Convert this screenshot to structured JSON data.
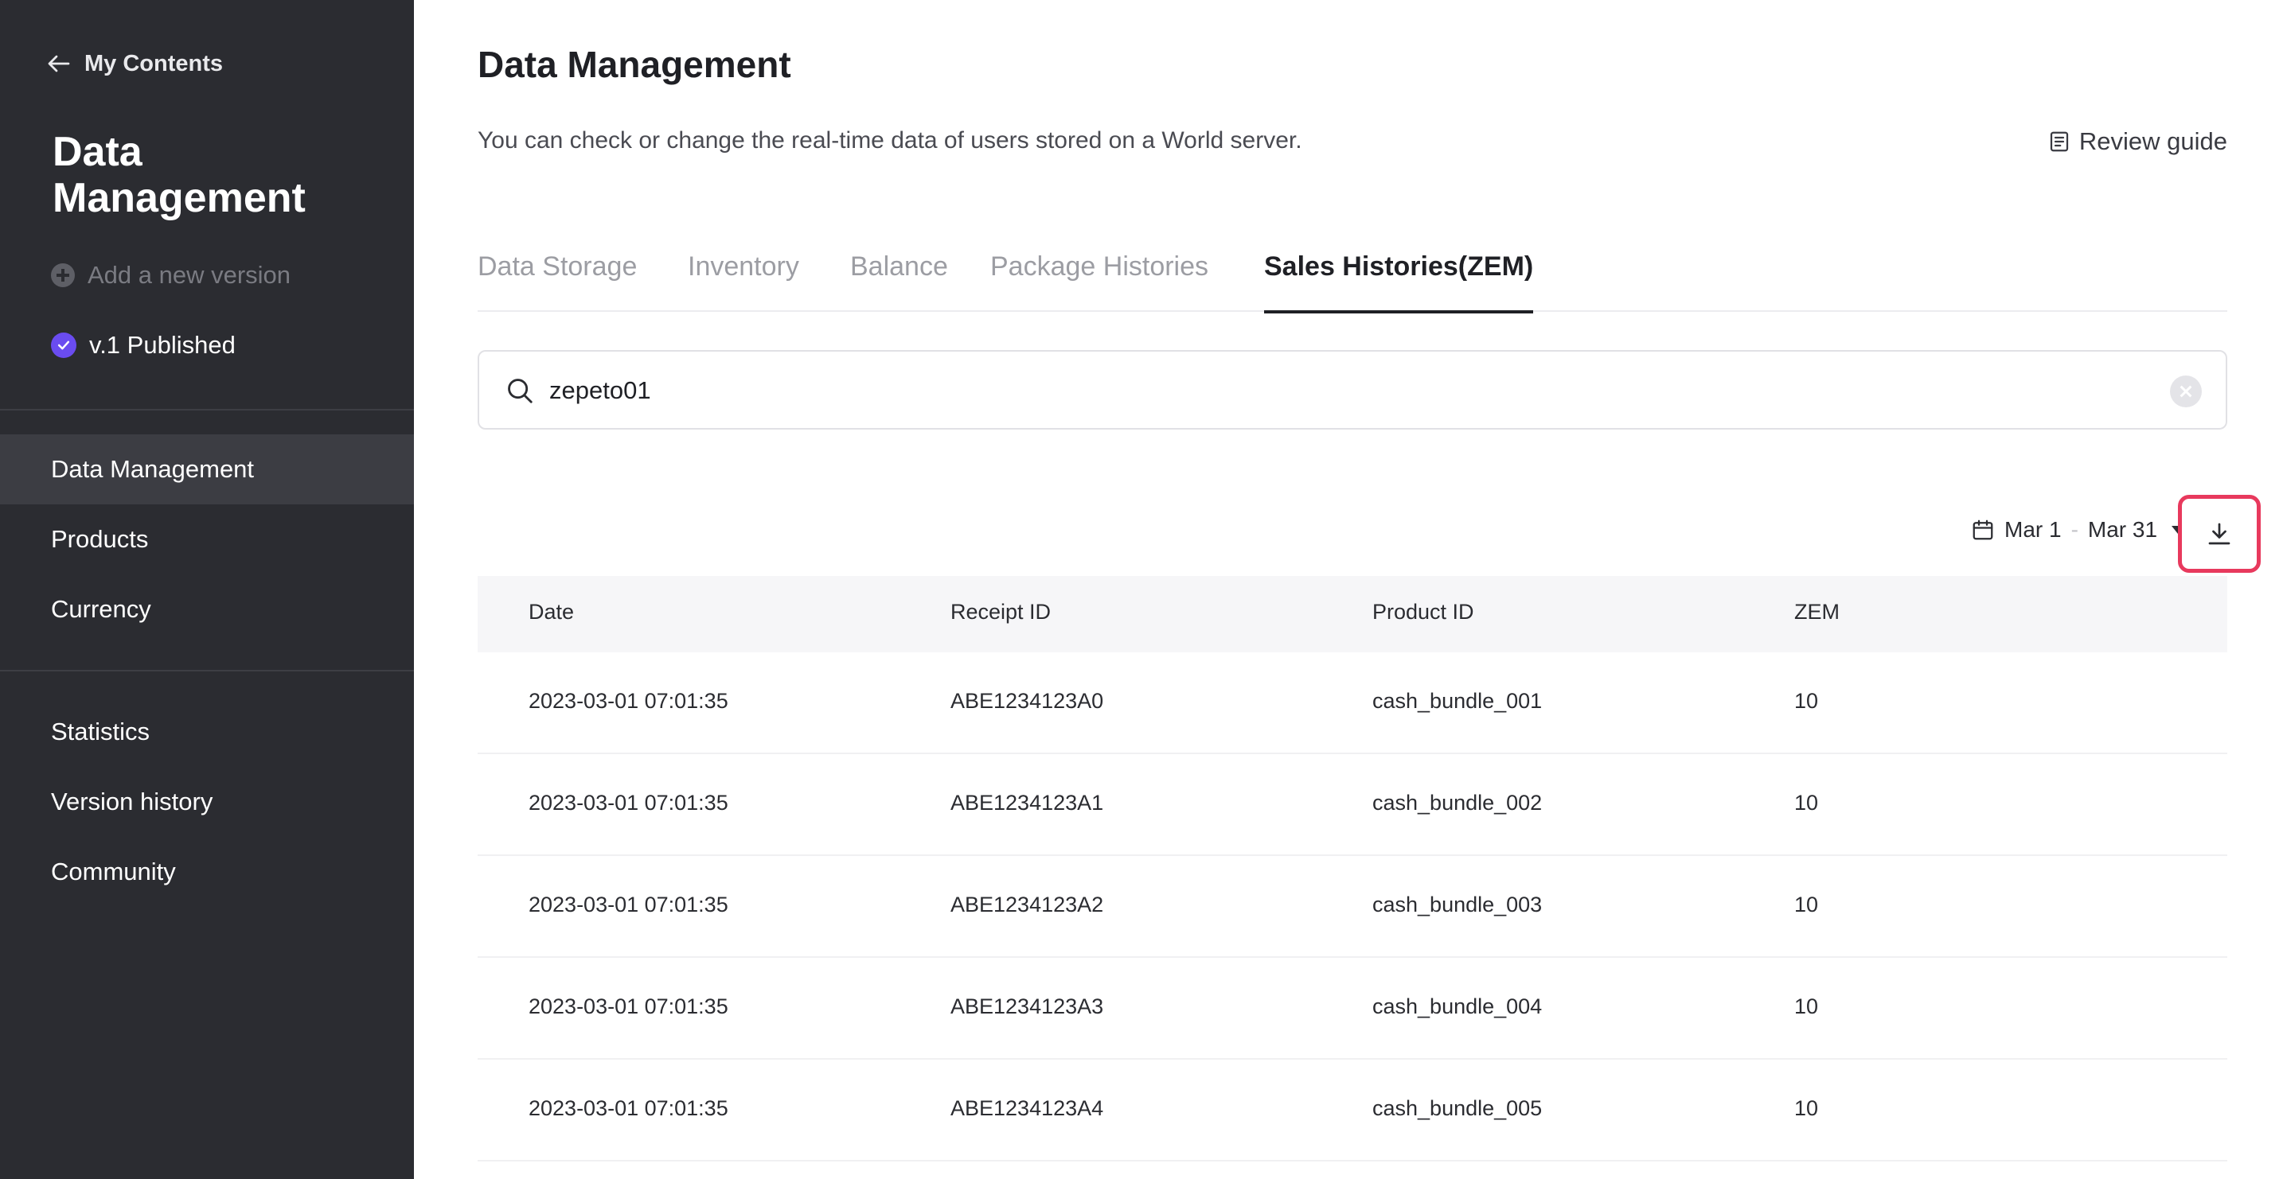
{
  "sidebar": {
    "back_label": "My Contents",
    "title": "Data Management",
    "add_version_label": "Add a new version",
    "version_label": "v.1 Published",
    "nav_primary": [
      {
        "label": "Data Management",
        "active": true
      },
      {
        "label": "Products",
        "active": false
      },
      {
        "label": "Currency",
        "active": false
      }
    ],
    "nav_secondary": [
      {
        "label": "Statistics"
      },
      {
        "label": "Version history"
      },
      {
        "label": "Community"
      }
    ]
  },
  "main": {
    "title": "Data Management",
    "description": "You can check or change the real-time data of users stored on a World server.",
    "review_guide_label": "Review guide",
    "tabs": [
      {
        "label": "Data Storage",
        "active": false
      },
      {
        "label": "Inventory",
        "active": false
      },
      {
        "label": "Balance",
        "active": false
      },
      {
        "label": "Package Histories",
        "active": false
      },
      {
        "label": "Sales Histories(ZEM)",
        "active": true
      }
    ],
    "search": {
      "value": "zepeto01"
    },
    "date_filter": {
      "start": "Mar 1",
      "separator": "-",
      "end": "Mar 31"
    },
    "table": {
      "headers": [
        "Date",
        "Receipt ID",
        "Product ID",
        "ZEM"
      ],
      "rows": [
        [
          "2023-03-01 07:01:35",
          "ABE1234123A0",
          "cash_bundle_001",
          "10"
        ],
        [
          "2023-03-01 07:01:35",
          "ABE1234123A1",
          "cash_bundle_002",
          "10"
        ],
        [
          "2023-03-01 07:01:35",
          "ABE1234123A2",
          "cash_bundle_003",
          "10"
        ],
        [
          "2023-03-01 07:01:35",
          "ABE1234123A3",
          "cash_bundle_004",
          "10"
        ],
        [
          "2023-03-01 07:01:35",
          "ABE1234123A4",
          "cash_bundle_005",
          "10"
        ]
      ]
    }
  },
  "icons": {
    "back": "arrow-left-icon",
    "add": "plus-circle-icon",
    "published": "check-circle-icon",
    "review": "document-icon",
    "search": "search-icon",
    "clear": "clear-icon",
    "calendar": "calendar-icon",
    "download": "download-icon"
  },
  "colors": {
    "sidebar_bg": "#2b2c31",
    "sidebar_active": "#3c3d43",
    "accent_purple": "#6a4cf0",
    "highlight_red": "#e8395d"
  }
}
